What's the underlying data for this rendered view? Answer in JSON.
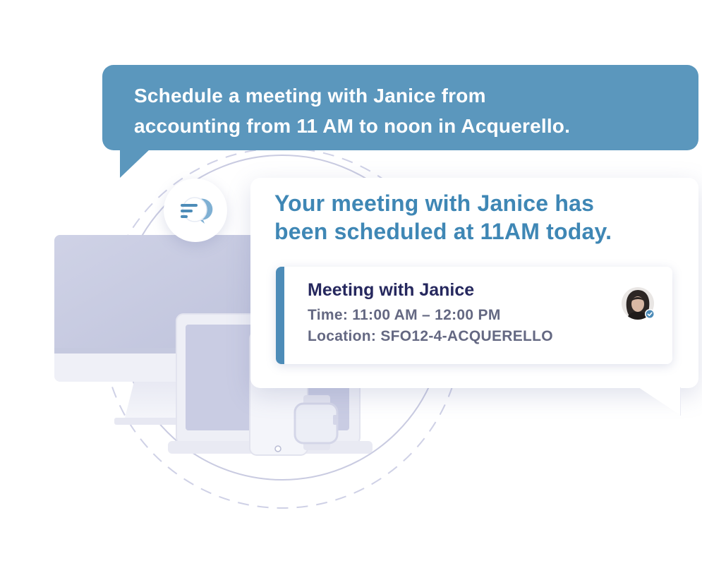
{
  "user_message": {
    "line1": "Schedule a meeting with Janice from",
    "line2": "accounting from 11 AM to noon in Acquerello."
  },
  "assistant_message": {
    "line1": "Your meeting with Janice has",
    "line2": "been scheduled at 11AM today."
  },
  "meeting_card": {
    "title": "Meeting with Janice",
    "time": "Time: 11:00 AM – 12:00 PM",
    "location": "Location: SFO12-4-ACQUERELLO",
    "attendee_status": "accepted"
  },
  "icons": {
    "chat": "chat-bubbles-icon",
    "avatar_badge": "check-icon"
  },
  "colors": {
    "user_bubble": "#5b97bd",
    "assistant_text": "#3f87b5",
    "meeting_accent": "#4d8cb8",
    "meeting_title": "#26285e",
    "meeting_detail": "#646882",
    "device_fill": "#cdd0e5"
  }
}
